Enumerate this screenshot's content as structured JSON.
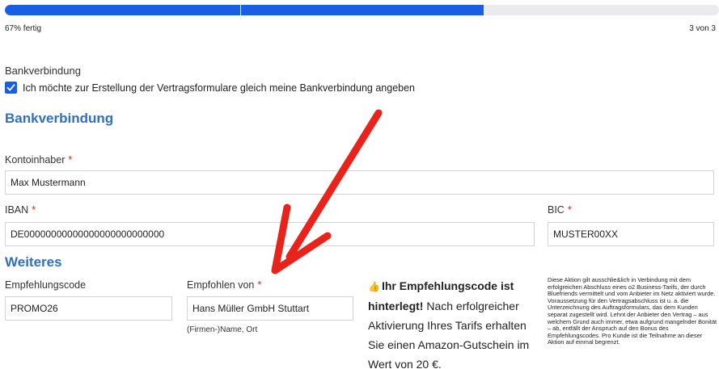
{
  "progress": {
    "fraction": 0.67,
    "percent_label": "67% fertig",
    "step_label": "3 von 3"
  },
  "bank_toggle": {
    "heading": "Bankverbindung",
    "checkbox_label": "Ich möchte zur Erstellung der Vertragsformulare gleich meine Bankverbindung angeben",
    "checked": true
  },
  "bank_section": {
    "title": "Bankverbindung",
    "account_holder": {
      "label": "Kontoinhaber",
      "required_mark": "*",
      "value": "Max Mustermann"
    },
    "iban": {
      "label": "IBAN",
      "required_mark": "*",
      "value": "DE00000000000000000000000000"
    },
    "bic": {
      "label": "BIC",
      "required_mark": "*",
      "value": "MUSTER00XX"
    }
  },
  "more_section": {
    "title": "Weiteres",
    "referral_code": {
      "label": "Empfehlungscode",
      "value": "PROMO26"
    },
    "referred_by": {
      "label": "Empfohlen von",
      "required_mark": "*",
      "value": "Hans Müller GmbH Stuttart",
      "hint": "(Firmen-)Name, Ort"
    },
    "promo": {
      "emoji": "👍",
      "bold_text": "Ihr Empfehlungscode ist hinterlegt!",
      "text": " Nach erfolgreicher Aktivierung Ihres Tarifs erhalten Sie einen Amazon-Gutschein im Wert von 20 €."
    },
    "legal": "Diese Aktion gilt ausschlie&lich in Verbindung mit dem erfolgreichen Abschluss eines o2 Business-Tarifs, der durch Bluefriends vermittelt und vom Anbieter im Netz aktiviert wurde. Voraussetzung für den Vertragsabschluss ist u. a. die Unterzeichnung des Auftragsformulars, das dem Kunden separat zugestellt wird. Lehnt der Anbieter den Vertrag – aus welchem Grund auch immer, etwa aufgrund mangelnder Bonität – ab, entfällt der Anspruch auf den Bonus des Empfehlungscodes. Pro Kunde ist die Teilnahme an dieser Aktion auf einmal begrenzt."
  },
  "colors": {
    "accent": "#1a5ee6",
    "heading": "#2f6fc0",
    "required": "#d0251f",
    "arrow": "#e8231b"
  }
}
